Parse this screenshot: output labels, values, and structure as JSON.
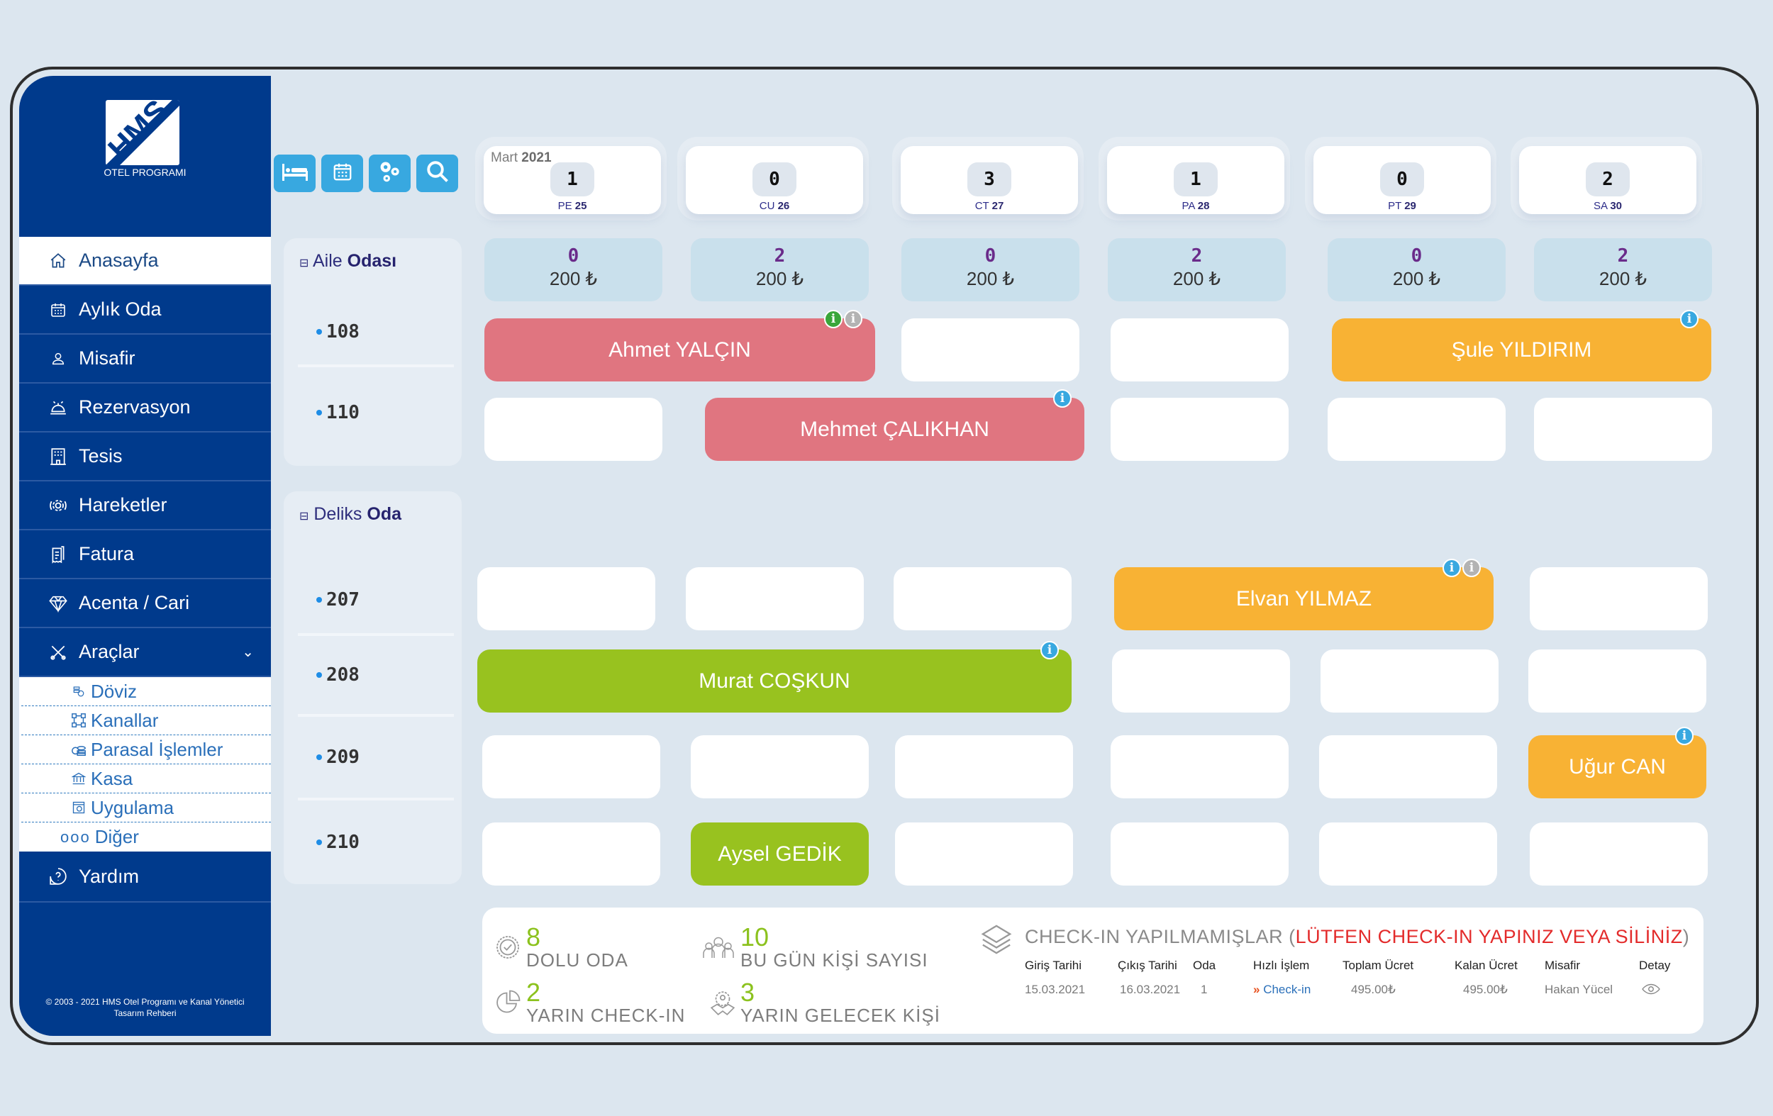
{
  "app": {
    "logo_text": "HMS",
    "logo_subtitle": "OTEL PROGRAMI",
    "copyright_line1": "© 2003 - 2021 HMS Otel Programı ve Kanal Yönetici",
    "copyright_line2": "Tasarım Rehberi"
  },
  "sidebar": {
    "items": [
      {
        "label": "Anasayfa",
        "icon": "home-icon",
        "active": true
      },
      {
        "label": "Aylık Oda",
        "icon": "calendar-icon"
      },
      {
        "label": "Misafir",
        "icon": "user-icon"
      },
      {
        "label": "Rezervasyon",
        "icon": "reception-bell-icon"
      },
      {
        "label": "Tesis",
        "icon": "building-icon"
      },
      {
        "label": "Hareketler",
        "icon": "gear-cycle-icon"
      },
      {
        "label": "Fatura",
        "icon": "invoice-icon"
      },
      {
        "label": "Acenta / Cari",
        "icon": "diamond-icon"
      },
      {
        "label": "Araçlar",
        "icon": "tools-icon",
        "expanded": true
      }
    ],
    "subitems": [
      {
        "label": "Döviz",
        "icon": "currency-icon"
      },
      {
        "label": "Kanallar",
        "icon": "channels-icon"
      },
      {
        "label": "Parasal İşlemler",
        "icon": "coins-icon"
      },
      {
        "label": "Kasa",
        "icon": "bank-icon"
      },
      {
        "label": "Uygulama",
        "icon": "app-settings-icon"
      },
      {
        "label": "Diğer",
        "icon": "more-dots-icon",
        "prefix": "ooo"
      }
    ],
    "help": {
      "label": "Yardım",
      "icon": "help-icon"
    }
  },
  "toolbar": [
    {
      "name": "bed-icon"
    },
    {
      "name": "calendar-icon"
    },
    {
      "name": "gears-icon"
    },
    {
      "name": "search-icon"
    }
  ],
  "calendar": {
    "month": "Mart",
    "year": "2021",
    "days": [
      {
        "count": "1",
        "dow": "PE",
        "day": "25"
      },
      {
        "count": "0",
        "dow": "CU",
        "day": "26"
      },
      {
        "count": "3",
        "dow": "CT",
        "day": "27"
      },
      {
        "count": "1",
        "dow": "PA",
        "day": "28"
      },
      {
        "count": "0",
        "dow": "PT",
        "day": "29"
      },
      {
        "count": "2",
        "dow": "SA",
        "day": "30"
      }
    ]
  },
  "categories": [
    {
      "name_light": "Aile",
      "name_bold": "Odası",
      "prices": [
        {
          "available": "0",
          "price": "200 ₺"
        },
        {
          "available": "2",
          "price": "200 ₺"
        },
        {
          "available": "0",
          "price": "200 ₺"
        },
        {
          "available": "2",
          "price": "200 ₺"
        },
        {
          "available": "0",
          "price": "200 ₺"
        },
        {
          "available": "2",
          "price": "200 ₺"
        }
      ],
      "rooms": [
        "108",
        "110"
      ]
    },
    {
      "name_light": "Deliks",
      "name_bold": "Oda",
      "rooms": [
        "207",
        "208",
        "209",
        "210"
      ]
    }
  ],
  "bookings": [
    {
      "first": "Ahmet",
      "last": "YALÇIN",
      "room": "108",
      "color": "#e07580",
      "badges": [
        "green",
        "gray"
      ]
    },
    {
      "first": "Şule",
      "last": "YILDIRIM",
      "room": "108",
      "color": "#f8b234",
      "badges": [
        "blue"
      ]
    },
    {
      "first": "Mehmet",
      "last": "ÇALIKHAN",
      "room": "110",
      "color": "#e07580",
      "badges": [
        "blue"
      ]
    },
    {
      "first": "Elvan",
      "last": "YILMAZ",
      "room": "207",
      "color": "#f8b234",
      "badges": [
        "blue",
        "gray"
      ]
    },
    {
      "first": "Murat",
      "last": "COŞKUN",
      "room": "208",
      "color": "#98c21f",
      "badges": [
        "blue"
      ]
    },
    {
      "first": "Uğur",
      "last": "CAN",
      "room": "209",
      "color": "#f8b234",
      "badges": [
        "blue"
      ]
    },
    {
      "first": "Aysel",
      "last": "GEDİK",
      "room": "210",
      "color": "#98c21f",
      "badges": []
    }
  ],
  "summary": {
    "stats": [
      {
        "value": "8",
        "label": "DOLU ODA",
        "icon": "badge-check-icon"
      },
      {
        "value": "10",
        "label": "BU GÜN KİŞİ SAYISI",
        "icon": "people-icon"
      },
      {
        "value": "2",
        "label": "YARIN CHECK-IN",
        "icon": "pie-chart-icon"
      },
      {
        "value": "3",
        "label": "YARIN GELECEK KİŞİ",
        "icon": "handshake-icon"
      }
    ],
    "checkin_title": "CHECK-IN YAPILMAMIŞLAR (",
    "checkin_warning": "LÜTFEN CHECK-IN YAPINIZ VEYA SİLİNİZ",
    "checkin_close": ")",
    "columns": [
      "Giriş Tarihi",
      "Çıkış Tarihi",
      "Oda",
      "Hızlı İşlem",
      "Toplam Ücret",
      "Kalan Ücret",
      "Misafir",
      "Detay"
    ],
    "rows": [
      {
        "giris": "15.03.2021",
        "cikis": "16.03.2021",
        "oda": "1",
        "islem_arrow": "»",
        "islem": "Check-in",
        "toplam": "495.00₺",
        "kalan": "495.00₺",
        "misafir": "Hakan Yücel",
        "detay_icon": "eye-icon"
      }
    ]
  }
}
